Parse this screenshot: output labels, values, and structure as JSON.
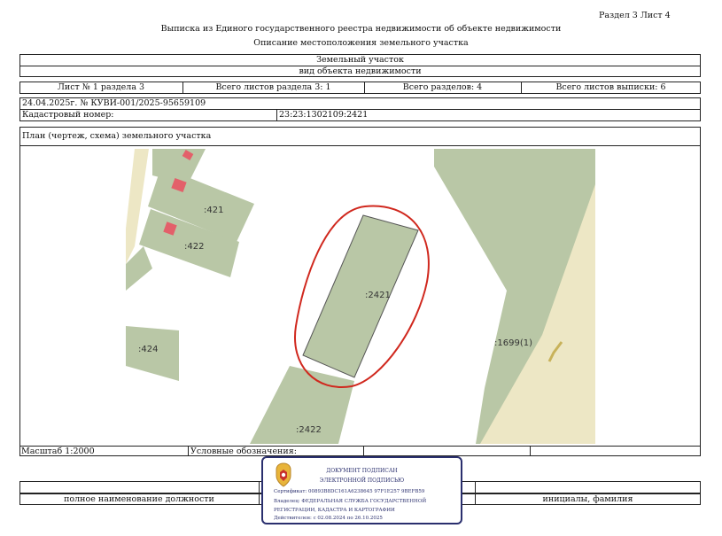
{
  "header": {
    "section_sheet": "Раздел 3   Лист 4",
    "title_line1": "Выписка из Единого государственного реестра недвижимости об объекте недвижимости",
    "title_line2": "Описание местоположения земельного участка"
  },
  "object": {
    "type": "Земельный участок",
    "type_caption": "вид объекта недвижимости"
  },
  "sheets": {
    "sheet_no": "Лист № 1 раздела 3",
    "total_sheets_section": "Всего листов раздела 3: 1",
    "total_sections": "Всего разделов: 4",
    "total_sheets_extract": "Всего листов выписки: 6"
  },
  "record": {
    "date_no": "24.04.2025г. № КУВИ-001/2025-95659109",
    "cadastral_label": "Кадастровый номер:",
    "cadastral_value": "23:23:1302109:2421"
  },
  "plan": {
    "title": "План (чертеж, схема) земельного участка",
    "labels": {
      "p421": ":421",
      "p422": ":422",
      "p424": ":424",
      "p2421": ":2421",
      "p2422": ":2422",
      "p1699": ":1699(1)"
    },
    "colors": {
      "parcel_fill": "#b9c7a6",
      "road_fill": "#ede7c5",
      "highlight": "#d0281e",
      "building": "#e3606a"
    }
  },
  "footer": {
    "scale": "Масштаб 1:2000",
    "legend_label": "Условные обозначения:",
    "position_caption": "полное наименование должности",
    "name_caption": "инициалы, фамилия"
  },
  "stamp": {
    "line1": "ДОКУМЕНТ ПОДПИСАН",
    "line2": "ЭЛЕКТРОННОЙ ПОДПИСЬЮ",
    "certificate": "Сертификат: 00893B8DC161A6238645 97F1E257 9BEFB59",
    "owner_line1": "Владелец: ФЕДЕРАЛЬНАЯ СЛУЖБА ГОСУДАРСТВЕННОЙ",
    "owner_line2": "РЕГИСТРАЦИИ, КАДАСТРА И КАРТОГРАФИИ",
    "valid": "Действителен: с 02.08.2024 по 26.10.2025",
    "color": "#2a2f6e"
  }
}
